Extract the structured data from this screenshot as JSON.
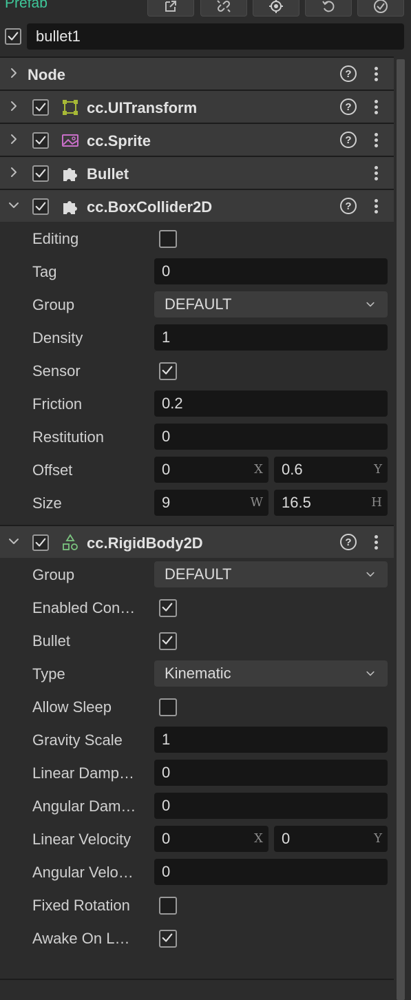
{
  "topbar": {
    "label": "Prefab"
  },
  "node": {
    "name": "bullet1",
    "active": true
  },
  "colors": {
    "accent": "#3fc89a",
    "transform_icon": "#a7b936",
    "sprite_icon": "#c86fc8",
    "rigidbody_icon": "#7bc47f"
  },
  "components": {
    "node": {
      "title": "Node"
    },
    "uitransform": {
      "title": "cc.UITransform"
    },
    "sprite": {
      "title": "cc.Sprite"
    },
    "bullet": {
      "title": "Bullet"
    },
    "boxcollider": {
      "title": "cc.BoxCollider2D",
      "editing_label": "Editing",
      "tag_label": "Tag",
      "tag_value": "0",
      "group_label": "Group",
      "group_value": "DEFAULT",
      "density_label": "Density",
      "density_value": "1",
      "sensor_label": "Sensor",
      "friction_label": "Friction",
      "friction_value": "0.2",
      "restitution_label": "Restitution",
      "restitution_value": "0",
      "offset_label": "Offset",
      "offset_x": "0",
      "offset_x_unit": "X",
      "offset_y": "0.6",
      "offset_y_unit": "Y",
      "size_label": "Size",
      "size_w": "9",
      "size_w_unit": "W",
      "size_h": "16.5",
      "size_h_unit": "H"
    },
    "rigidbody": {
      "title": "cc.RigidBody2D",
      "group_label": "Group",
      "group_value": "DEFAULT",
      "enabled_contact_label": "Enabled Con…",
      "bullet_label": "Bullet",
      "type_label": "Type",
      "type_value": "Kinematic",
      "allow_sleep_label": "Allow Sleep",
      "gravity_label": "Gravity Scale",
      "gravity_value": "1",
      "linear_damping_label": "Linear Damp…",
      "linear_damping_value": "0",
      "angular_damping_label": "Angular Dam…",
      "angular_damping_value": "0",
      "linear_velocity_label": "Linear Velocity",
      "lv_x": "0",
      "lv_x_unit": "X",
      "lv_y": "0",
      "lv_y_unit": "Y",
      "angular_velocity_label": "Angular Velo…",
      "angular_velocity_value": "0",
      "fixed_rotation_label": "Fixed Rotation",
      "awake_label": "Awake On L…"
    }
  }
}
